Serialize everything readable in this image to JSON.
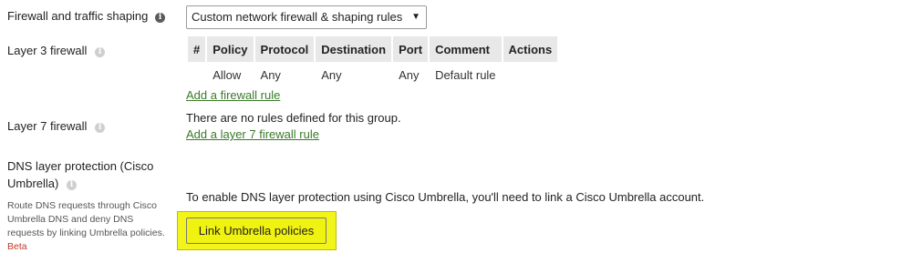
{
  "shaping": {
    "label": "Firewall and traffic shaping",
    "select_value": "Custom network firewall & shaping rules"
  },
  "layer3": {
    "label": "Layer 3 firewall",
    "columns": [
      "#",
      "Policy",
      "Protocol",
      "Destination",
      "Port",
      "Comment",
      "Actions"
    ],
    "rows": [
      {
        "num": "",
        "policy": "Allow",
        "protocol": "Any",
        "destination": "Any",
        "port": "Any",
        "comment": "Default rule",
        "actions": ""
      }
    ],
    "add_link": "Add a firewall rule"
  },
  "layer7": {
    "label": "Layer 7 firewall",
    "empty_text": "There are no rules defined for this group.",
    "add_link": "Add a layer 7 firewall rule"
  },
  "dns": {
    "label_line1": "DNS layer protection (Cisco",
    "label_line2": "Umbrella)",
    "description": "Route DNS requests through Cisco Umbrella DNS and deny DNS requests by linking Umbrella policies.",
    "beta": "Beta",
    "message": "To enable DNS layer protection using Cisco Umbrella, you'll need to link a Cisco Umbrella account.",
    "button_label": "Link Umbrella policies"
  },
  "colors": {
    "link": "#3a7a2a",
    "highlight": "#f3f51a",
    "header_bg": "#e8e8e8",
    "beta": "#c0392b"
  },
  "icons": {
    "info": "info-circle-icon",
    "dropdown": "caret-down-icon"
  }
}
